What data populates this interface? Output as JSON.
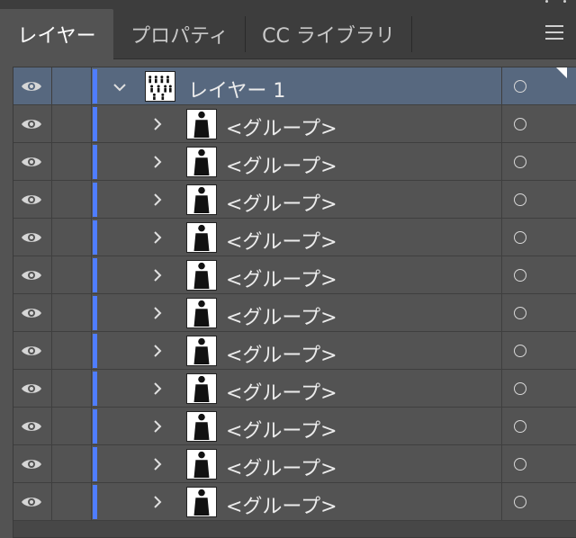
{
  "tabs": [
    {
      "label": "レイヤー",
      "active": true
    },
    {
      "label": "プロパティ",
      "active": false
    },
    {
      "label": "CC ライブラリ",
      "active": false
    }
  ],
  "layer": {
    "name": "レイヤー 1",
    "expanded": true,
    "color": "#4f7dff",
    "groups": [
      {
        "name": "<グループ>",
        "icon": "businessman-presenting-icon"
      },
      {
        "name": "<グループ>",
        "icon": "businessman-crouching-icon"
      },
      {
        "name": "<グループ>",
        "icon": "businessman-pointing-icon"
      },
      {
        "name": "<グループ>",
        "icon": "businessman-at-desk-icon"
      },
      {
        "name": "<グループ>",
        "icon": "businessman-walking-icon"
      },
      {
        "name": "<グループ>",
        "icon": "businessman-standing-icon"
      },
      {
        "name": "<グループ>",
        "icon": "businessman-on-phone-icon"
      },
      {
        "name": "<グループ>",
        "icon": "businessman-side-view-icon"
      },
      {
        "name": "<グループ>",
        "icon": "businessman-with-bag-icon"
      },
      {
        "name": "<グループ>",
        "icon": "businessman-front-icon"
      },
      {
        "name": "<グループ>",
        "icon": "businessman-suit-icon"
      }
    ]
  }
}
